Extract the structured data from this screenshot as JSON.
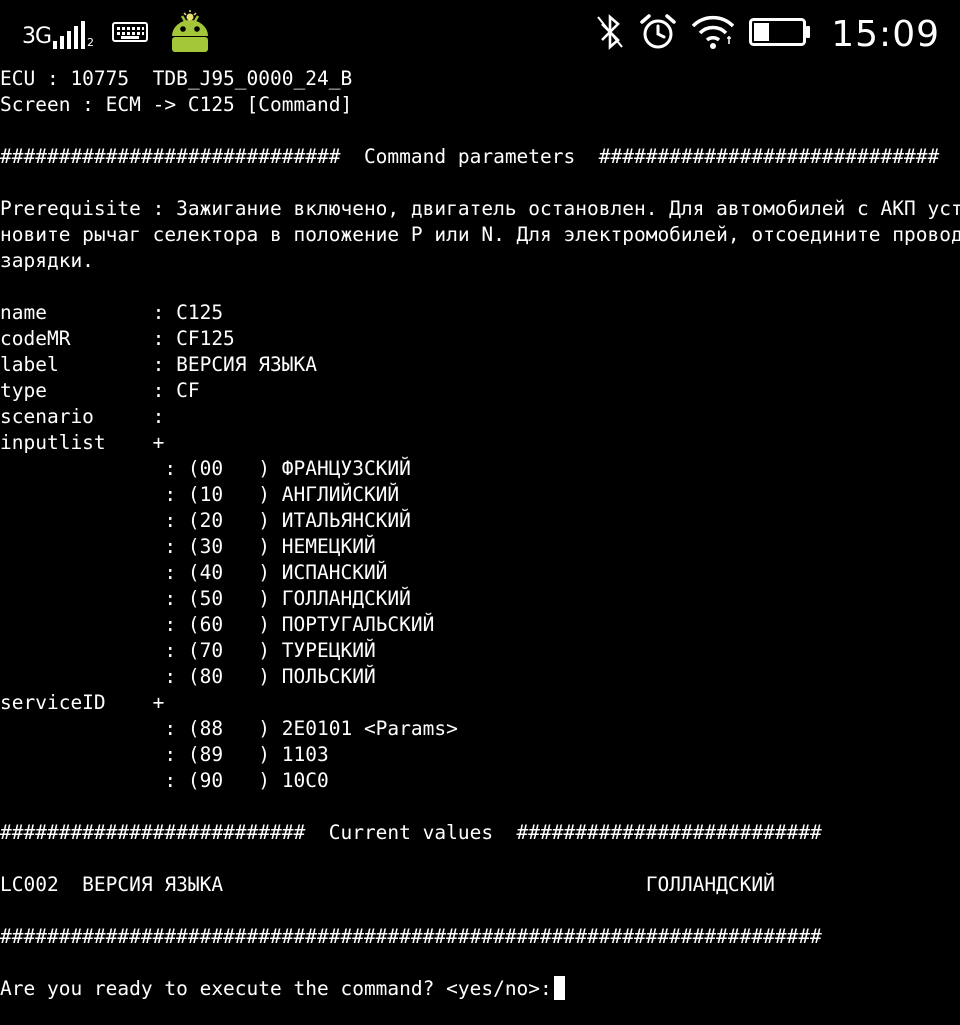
{
  "status_bar": {
    "network_type": "3G",
    "sim_slot": "2",
    "clock": "15:09"
  },
  "terminal": {
    "lines": [
      "ECU : 10775  TDB_J95_0000_24_B",
      "Screen : ECM -> C125 [Command]",
      "",
      "#############################  Command parameters  #############################",
      "",
      "Prerequisite : Зажигание включено, двигатель остановлен. Для автомобилей с АКП уста",
      "новите рычаг селектора в положение P или N. Для электромобилей, отсоедините провод",
      "зарядки.",
      "",
      "name         : C125",
      "codeMR       : CF125",
      "label        : ВЕРСИЯ ЯЗЫКА",
      "type         : CF",
      "scenario     :",
      "inputlist    +",
      "              : (00   ) ФРАНЦУЗСКИЙ",
      "              : (10   ) АНГЛИЙСКИЙ",
      "              : (20   ) ИТАЛЬЯНСКИЙ",
      "              : (30   ) НЕМЕЦКИЙ",
      "              : (40   ) ИСПАНСКИЙ",
      "              : (50   ) ГОЛЛАНДСКИЙ",
      "              : (60   ) ПОРТУГАЛЬСКИЙ",
      "              : (70   ) ТУРЕЦКИЙ",
      "              : (80   ) ПОЛЬСКИЙ",
      "serviceID    +",
      "              : (88   ) 2E0101 <Params>",
      "              : (89   ) 1103",
      "              : (90   ) 10C0",
      "",
      "##########################  Current values  ##########################",
      "",
      "LC002  ВЕРСИЯ ЯЗЫКА                                    ГОЛЛАНДСКИЙ",
      "",
      "######################################################################",
      "",
      "Are you ready to execute the command? <yes/no>:"
    ]
  },
  "colors": {
    "background": "#000000",
    "foreground": "#ffffff",
    "robot_icon": "#a4c639"
  },
  "icons": {
    "keyboard": "keyboard-icon",
    "robot": "android-debug-icon",
    "bluetooth": "bluetooth-off-icon",
    "alarm": "alarm-clock-icon",
    "wifi": "wifi-icon",
    "battery": "battery-icon"
  },
  "battery_level": 0.3
}
